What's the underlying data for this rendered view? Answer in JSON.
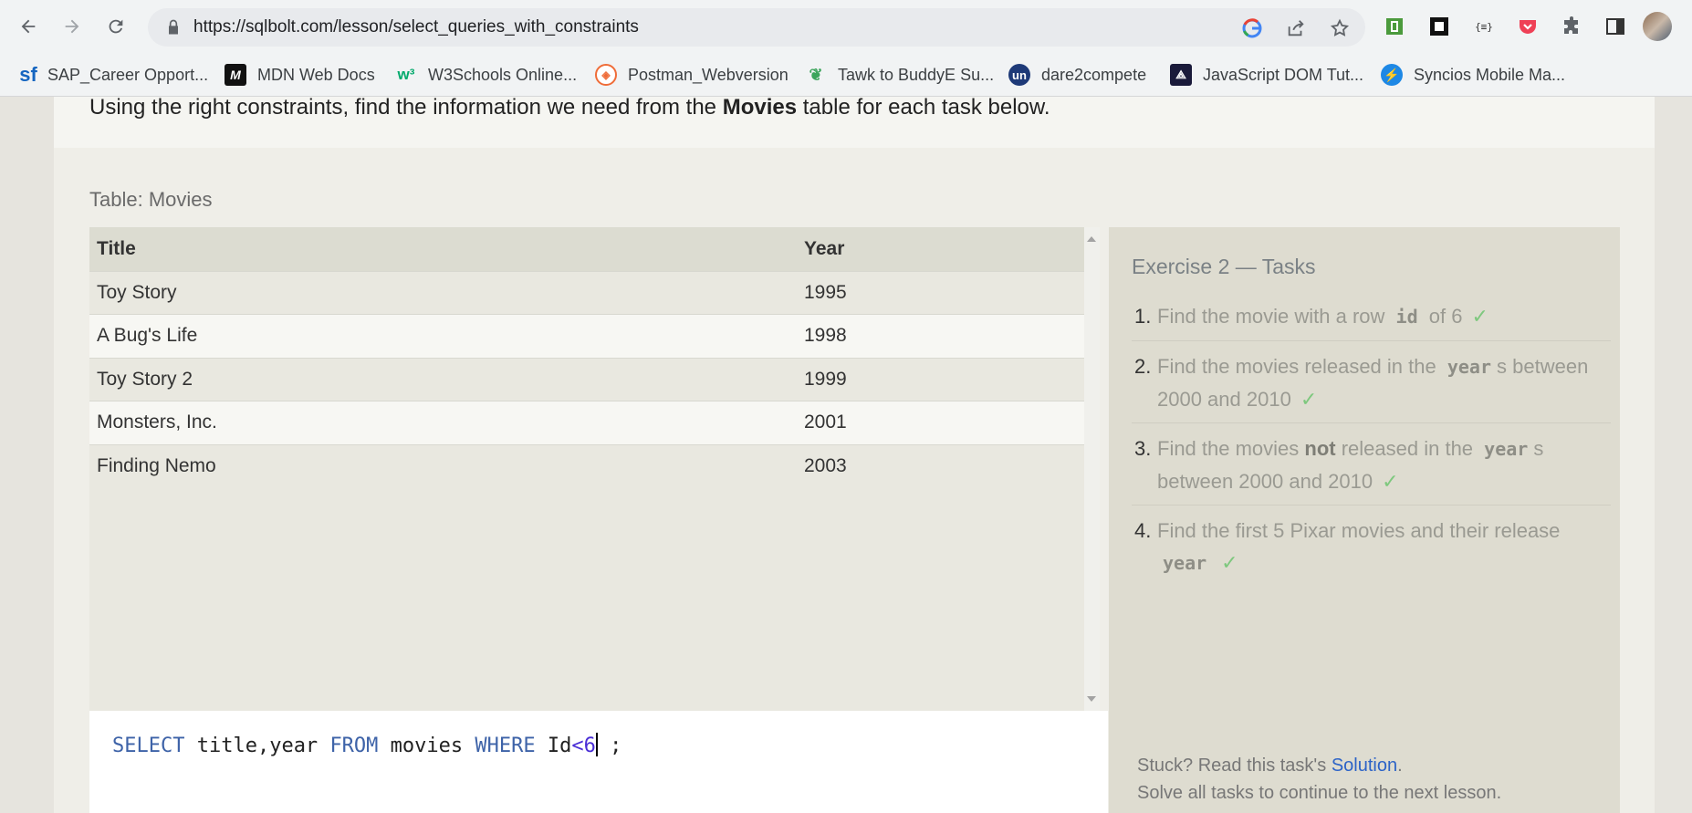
{
  "browser": {
    "url": "https://sqlbolt.com/lesson/select_queries_with_constraints",
    "bookmarks": [
      {
        "label": "SAP_Career Opport...",
        "icon": "sf-icon"
      },
      {
        "label": "MDN Web Docs",
        "icon": "mdn-icon"
      },
      {
        "label": "W3Schools Online...",
        "icon": "w3schools-icon"
      },
      {
        "label": "Postman_Webversion",
        "icon": "postman-icon"
      },
      {
        "label": "Tawk to BuddyE Su...",
        "icon": "tawk-icon"
      },
      {
        "label": "dare2compete",
        "icon": "dare2compete-icon"
      },
      {
        "label": "JavaScript DOM Tut...",
        "icon": "js-dom-icon"
      },
      {
        "label": "Syncios Mobile Ma...",
        "icon": "syncios-icon"
      }
    ]
  },
  "lesson": {
    "instruction_pre": "Using the right constraints, find the information we need from the ",
    "instruction_bold": "Movies",
    "instruction_post": " table for each task below.",
    "table_caption": "Table: Movies",
    "columns": [
      "Title",
      "Year"
    ],
    "rows": [
      {
        "title": "Toy Story",
        "year": "1995"
      },
      {
        "title": "A Bug's Life",
        "year": "1998"
      },
      {
        "title": "Toy Story 2",
        "year": "1999"
      },
      {
        "title": "Monsters, Inc.",
        "year": "2001"
      },
      {
        "title": "Finding Nemo",
        "year": "2003"
      }
    ],
    "query": {
      "kw_select": "SELECT",
      "cols": " title,year ",
      "kw_from": "FROM",
      "table": " movies ",
      "kw_where": "WHERE",
      "cond_field": " Id",
      "cond_op": "<6",
      "end": " ;"
    }
  },
  "exercise": {
    "title": "Exercise 2 — Tasks",
    "tasks": [
      {
        "num": "1.",
        "a": "Find the movie with a row ",
        "code": "id",
        "b": " of 6"
      },
      {
        "num": "2.",
        "a": "Find the movies released in the ",
        "code": "year",
        "b": "s between 2000 and 2010"
      },
      {
        "num": "3.",
        "a": "Find the movies ",
        "bold": "not",
        "a2": " released in the ",
        "code": "year",
        "b": "s between 2000 and 2010"
      },
      {
        "num": "4.",
        "a": "Find the first 5 Pixar movies and their release ",
        "code": "year",
        "b": ""
      }
    ],
    "check": "✓",
    "stuck_pre": "Stuck? Read this task's ",
    "stuck_link": "Solution",
    "stuck_post": ".",
    "next_text": "Solve all tasks to continue to the next lesson."
  },
  "colors": {
    "keyword": "#3e63a8",
    "check": "#7ec87e",
    "link": "#2c63c7"
  }
}
